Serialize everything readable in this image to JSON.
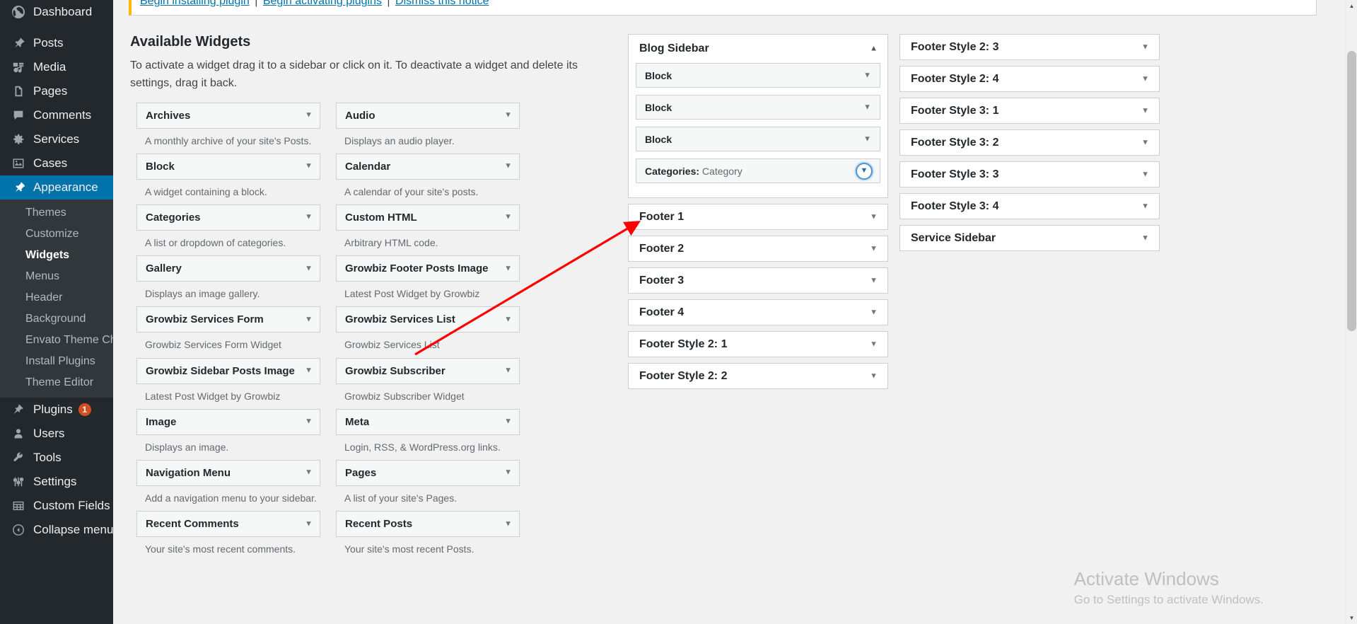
{
  "admin_menu": {
    "top_items": [
      {
        "label": "Dashboard",
        "icon": "dashboard-icon",
        "current": false
      },
      {
        "label": "Posts",
        "icon": "pin-icon",
        "current": false
      },
      {
        "label": "Media",
        "icon": "media-icon",
        "current": false
      },
      {
        "label": "Pages",
        "icon": "pages-icon",
        "current": false
      },
      {
        "label": "Comments",
        "icon": "comments-icon",
        "current": false
      },
      {
        "label": "Services",
        "icon": "gear-icon",
        "current": false
      },
      {
        "label": "Cases",
        "icon": "image-icon",
        "current": false
      },
      {
        "label": "Appearance",
        "icon": "brush-icon",
        "current": true
      }
    ],
    "appearance_submenu": [
      {
        "label": "Themes",
        "current": false
      },
      {
        "label": "Customize",
        "current": false
      },
      {
        "label": "Widgets",
        "current": true
      },
      {
        "label": "Menus",
        "current": false
      },
      {
        "label": "Header",
        "current": false
      },
      {
        "label": "Background",
        "current": false
      },
      {
        "label": "Envato Theme Check",
        "current": false
      },
      {
        "label": "Install Plugins",
        "current": false
      },
      {
        "label": "Theme Editor",
        "current": false
      }
    ],
    "bottom_items": [
      {
        "label": "Plugins",
        "icon": "plug-icon",
        "badge": "1"
      },
      {
        "label": "Users",
        "icon": "user-icon",
        "badge": ""
      },
      {
        "label": "Tools",
        "icon": "wrench-icon",
        "badge": ""
      },
      {
        "label": "Settings",
        "icon": "sliders-icon",
        "badge": ""
      },
      {
        "label": "Custom Fields",
        "icon": "grid-icon",
        "badge": ""
      },
      {
        "label": "Collapse menu",
        "icon": "collapse-icon",
        "badge": ""
      }
    ]
  },
  "notice": {
    "install_link": "Begin installing plugin",
    "activate_link": "Begin activating plugins",
    "dismiss_link": "Dismiss this notice",
    "separator": "|"
  },
  "available": {
    "title": "Available Widgets",
    "description": "To activate a widget drag it to a sidebar or click on it. To deactivate a widget and delete its settings, drag it back.",
    "widgets": [
      {
        "name": "Archives",
        "note": "A monthly archive of your site's Posts."
      },
      {
        "name": "Audio",
        "note": "Displays an audio player."
      },
      {
        "name": "Block",
        "note": "A widget containing a block."
      },
      {
        "name": "Calendar",
        "note": "A calendar of your site's posts."
      },
      {
        "name": "Categories",
        "note": "A list or dropdown of categories."
      },
      {
        "name": "Custom HTML",
        "note": "Arbitrary HTML code."
      },
      {
        "name": "Gallery",
        "note": "Displays an image gallery."
      },
      {
        "name": "Growbiz Footer Posts Image",
        "note": "Latest Post Widget by Growbiz"
      },
      {
        "name": "Growbiz Services Form",
        "note": "Growbiz Services Form Widget"
      },
      {
        "name": "Growbiz Services List",
        "note": "Growbiz Services List"
      },
      {
        "name": "Growbiz Sidebar Posts Image",
        "note": "Latest Post Widget by Growbiz"
      },
      {
        "name": "Growbiz Subscriber",
        "note": "Growbiz Subscriber Widget"
      },
      {
        "name": "Image",
        "note": "Displays an image."
      },
      {
        "name": "Meta",
        "note": "Login, RSS, & WordPress.org links."
      },
      {
        "name": "Navigation Menu",
        "note": "Add a navigation menu to your sidebar."
      },
      {
        "name": "Pages",
        "note": "A list of your site's Pages."
      },
      {
        "name": "Recent Comments",
        "note": "Your site's most recent comments."
      },
      {
        "name": "Recent Posts",
        "note": "Your site's most recent Posts."
      }
    ]
  },
  "sidebars_column_1": [
    {
      "name": "Blog Sidebar",
      "open": true,
      "widgets": [
        {
          "title": "Block",
          "instance": "",
          "focused": false
        },
        {
          "title": "Block",
          "instance": "",
          "focused": false
        },
        {
          "title": "Block",
          "instance": "",
          "focused": false
        },
        {
          "title": "Categories:",
          "instance": "Category",
          "focused": true
        }
      ]
    },
    {
      "name": "Footer 1",
      "open": false,
      "widgets": []
    },
    {
      "name": "Footer 2",
      "open": false,
      "widgets": []
    },
    {
      "name": "Footer 3",
      "open": false,
      "widgets": []
    },
    {
      "name": "Footer 4",
      "open": false,
      "widgets": []
    },
    {
      "name": "Footer Style 2: 1",
      "open": false,
      "widgets": []
    },
    {
      "name": "Footer Style 2: 2",
      "open": false,
      "widgets": []
    }
  ],
  "sidebars_column_2": [
    {
      "name": "Footer Style 2: 3",
      "open": false,
      "widgets": []
    },
    {
      "name": "Footer Style 2: 4",
      "open": false,
      "widgets": []
    },
    {
      "name": "Footer Style 3: 1",
      "open": false,
      "widgets": []
    },
    {
      "name": "Footer Style 3: 2",
      "open": false,
      "widgets": []
    },
    {
      "name": "Footer Style 3: 3",
      "open": false,
      "widgets": []
    },
    {
      "name": "Footer Style 3: 4",
      "open": false,
      "widgets": []
    },
    {
      "name": "Service Sidebar",
      "open": false,
      "widgets": []
    }
  ],
  "watermark": {
    "title": "Activate Windows",
    "subtitle": "Go to Settings to activate Windows."
  },
  "colors": {
    "menu_bg": "#23282d",
    "menu_submenu_bg": "#32373c",
    "accent_blue": "#0073aa",
    "link_blue": "#0073aa",
    "notice_warning": "#ffb900",
    "badge_red": "#d54e21",
    "annotation_red": "#ff0000",
    "focus_ring": "#4f94d4",
    "page_bg": "#f1f1f1"
  }
}
